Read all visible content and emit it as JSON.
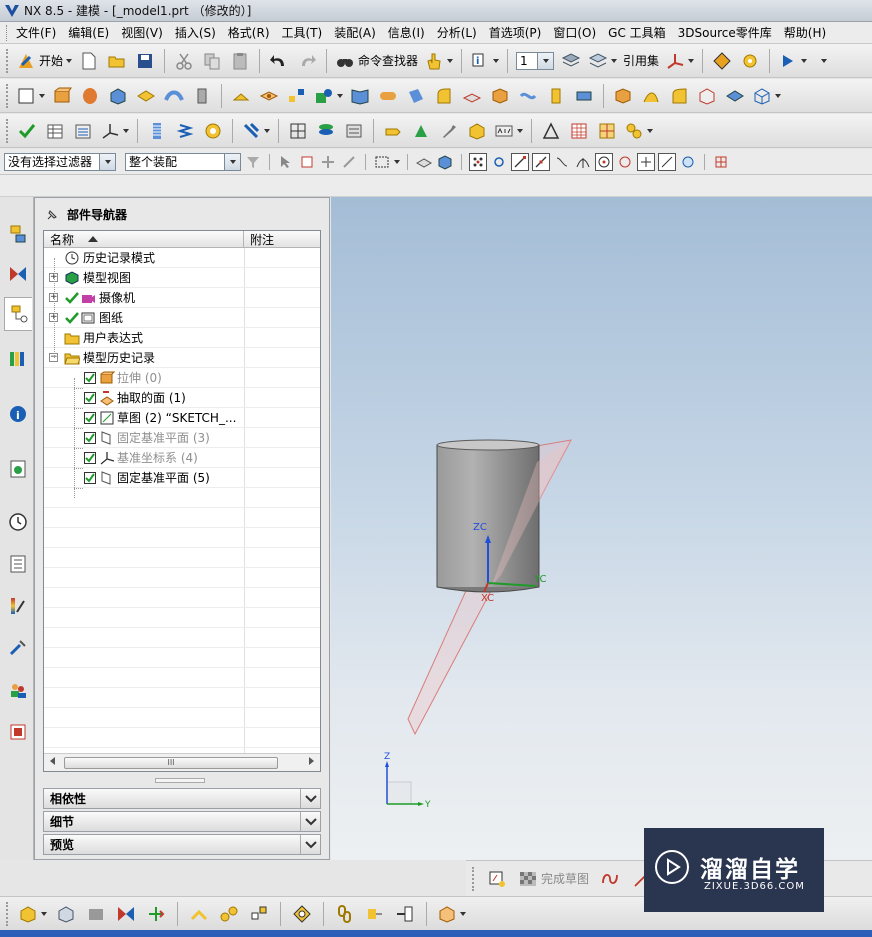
{
  "window": {
    "title": "NX 8.5 - 建模 - [_model1.prt （修改的）]"
  },
  "menu": [
    "文件(F)",
    "编辑(E)",
    "视图(V)",
    "插入(S)",
    "格式(R)",
    "工具(T)",
    "装配(A)",
    "信息(I)",
    "分析(L)",
    "首选项(P)",
    "窗口(O)",
    "GC 工具箱",
    "3DSource零件库",
    "帮助(H)"
  ],
  "toolbar1": {
    "start_label": "开始",
    "command_finder_label": "命令查找器",
    "layer_value": "1",
    "reference_set_label": "引用集"
  },
  "selection_bar": {
    "filter_value": "没有选择过滤器",
    "scope_value": "整个装配"
  },
  "navigator": {
    "title": "部件导航器",
    "columns": {
      "name": "名称",
      "note": "附注"
    },
    "rows": [
      {
        "label": "历史记录模式"
      },
      {
        "label": "模型视图"
      },
      {
        "label": "摄像机"
      },
      {
        "label": "图纸"
      },
      {
        "label": "用户表达式"
      },
      {
        "label": "模型历史记录"
      },
      {
        "label": "拉伸 (0)"
      },
      {
        "label": "抽取的面 (1)"
      },
      {
        "label": "草图 (2) “SKETCH_..."
      },
      {
        "label": "固定基准平面 (3)"
      },
      {
        "label": "基准坐标系 (4)"
      },
      {
        "label": "固定基准平面 (5)"
      }
    ],
    "scroll_grip": "III",
    "panels": [
      "相依性",
      "细节",
      "预览"
    ]
  },
  "viewport": {
    "axis_zc": "ZC",
    "axis_yc": "YC",
    "axis_xc": "XC",
    "triad_z": "Z",
    "triad_y": "Y"
  },
  "sketch_toolbar": {
    "finish_label": "完成草图"
  },
  "watermark": {
    "title": "溜溜自学",
    "subtitle": "ZIXUE.3D66.COM"
  },
  "colors": {
    "viewport_top": "#a4bdd6",
    "viewport_bottom": "#edf0f2",
    "cylinder": "#8e8e8e",
    "plane": "#e08a8a",
    "accent_check": "#1f9b2a"
  }
}
